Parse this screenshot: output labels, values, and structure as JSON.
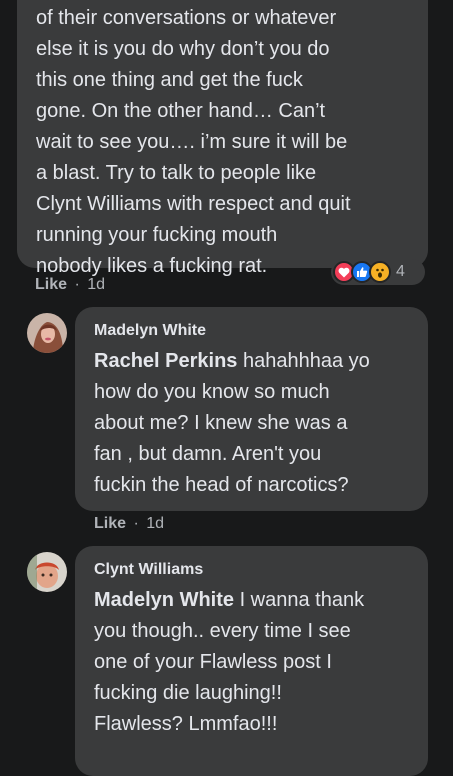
{
  "comments": [
    {
      "lines": [
        "of their conversations or whatever",
        "else it is you do why don’t you do",
        "this one thing and get the fuck",
        "gone. On the other hand… Can’t",
        "wait to see you…. i’m sure it will be",
        "a blast. Try to talk to people like",
        "Clynt Williams with respect and quit",
        "running your fucking mouth",
        "nobody likes a fucking rat."
      ],
      "like_label": "Like",
      "time": "1d",
      "reaction_count": "4",
      "reactions": [
        "love-icon",
        "like-icon",
        "wow-icon"
      ]
    },
    {
      "author": "Madelyn White",
      "mention": "Rachel Perkins",
      "first_line_rest": " hahahhhaa yo",
      "lines": [
        "how do you know so much",
        "about me? I knew she was a",
        "fan , but damn. Aren't you",
        "fuckin the head of narcotics?"
      ],
      "like_label": "Like",
      "time": "1d",
      "avatar": "avatar-madelyn-white"
    },
    {
      "author": "Clynt Williams",
      "mention": "Madelyn White",
      "first_line_rest": " I wanna thank",
      "lines": [
        "you though.. every time I see",
        "one of your Flawless post I",
        "fucking die laughing!!",
        "Flawless? Lmmfao!!!"
      ],
      "avatar": "avatar-clynt-williams"
    }
  ],
  "separator": "·",
  "colors": {
    "background": "#18191a",
    "bubble": "#3a3b3c",
    "text": "#e4e6eb",
    "secondary": "#b0b3b8",
    "love": "#f33e58",
    "like": "#1877f2",
    "wow": "#f7b125"
  }
}
